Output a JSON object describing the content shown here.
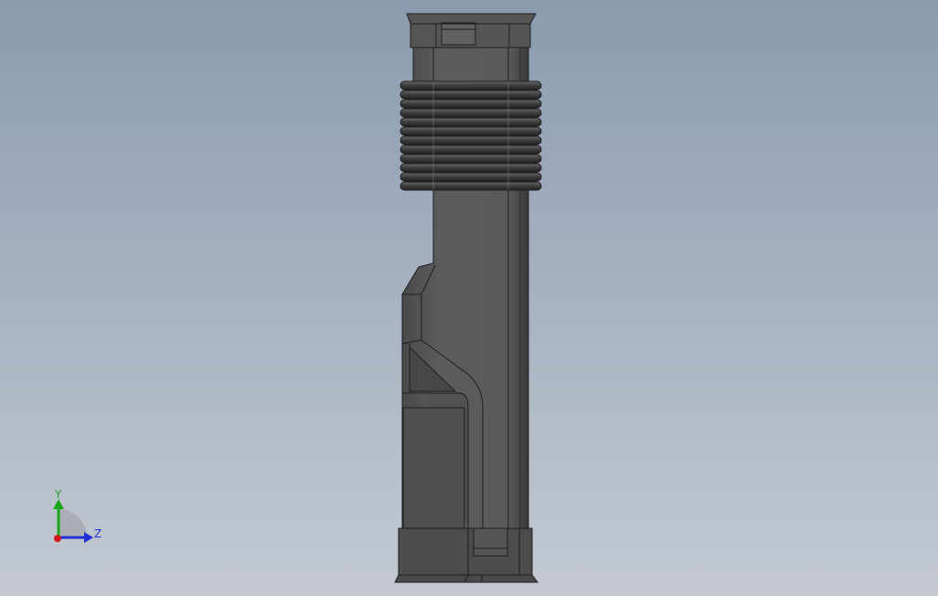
{
  "viewport": {
    "background_top": "#8a9bb0",
    "background_bottom": "#c4c9d2",
    "model_color": "#5a5a5a",
    "model_dark": "#3f3f3f",
    "model_light": "#6e6e6e",
    "edge_color": "#1e1e1e"
  },
  "triad": {
    "y_label": "Y",
    "z_label": "Z",
    "y_color": "#1aa51a",
    "z_color": "#1f2fd6",
    "x_color": "#d01a1a"
  },
  "model": {
    "name": "tube-part",
    "rib_count": 12
  }
}
